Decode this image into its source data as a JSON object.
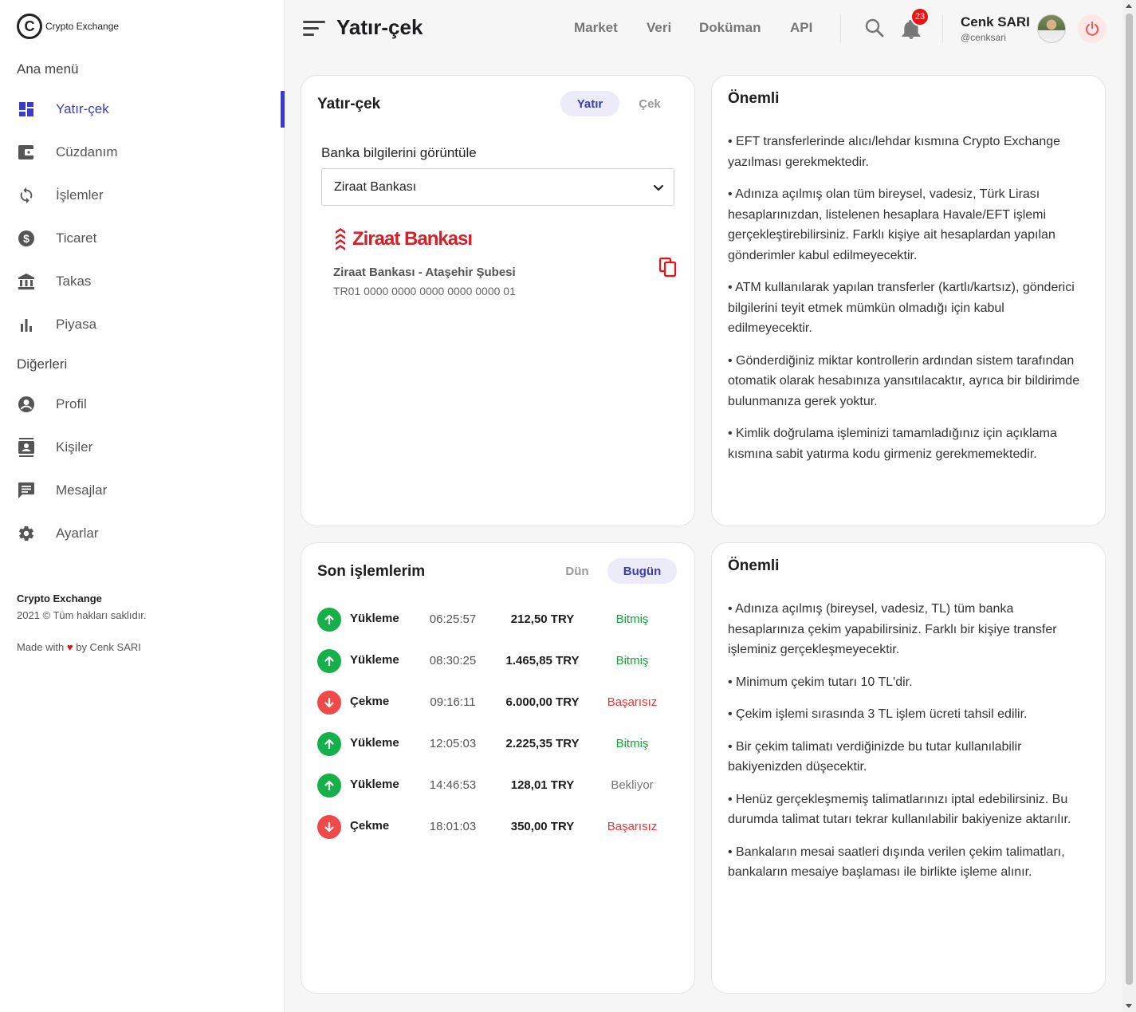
{
  "brand": {
    "mark": "C",
    "name": "Crypto Exchange"
  },
  "sidebar": {
    "main_title": "Ana menü",
    "main_items": [
      {
        "label": "Yatır-çek",
        "icon": "dashboard-icon",
        "active": true
      },
      {
        "label": "Cüzdanım",
        "icon": "wallet-icon"
      },
      {
        "label": "İşlemler",
        "icon": "sync-icon"
      },
      {
        "label": "Ticaret",
        "icon": "dollar-icon"
      },
      {
        "label": "Takas",
        "icon": "bank-icon"
      },
      {
        "label": "Piyasa",
        "icon": "bar-chart-icon"
      }
    ],
    "other_title": "Diğerleri",
    "other_items": [
      {
        "label": "Profil",
        "icon": "account-circle-icon"
      },
      {
        "label": "Kişiler",
        "icon": "contacts-icon"
      },
      {
        "label": "Mesajlar",
        "icon": "message-icon"
      },
      {
        "label": "Ayarlar",
        "icon": "gear-icon"
      }
    ],
    "footer": {
      "brand": "Crypto Exchange",
      "copyright": "2021 © Tüm hakları saklıdır.",
      "made_prefix": "Made with",
      "made_suffix": "by Cenk SARI"
    }
  },
  "header": {
    "title": "Yatır-çek",
    "nav": [
      "Market",
      "Veri",
      "Doküman",
      "API"
    ],
    "notification_count": "23",
    "user_name": "Cenk SARI",
    "user_handle": "@cenksari"
  },
  "deposit_card": {
    "title": "Yatır-çek",
    "tabs": [
      {
        "label": "Yatır",
        "active": true
      },
      {
        "label": "Çek",
        "active": false
      }
    ],
    "field_label": "Banka bilgilerini görüntüle",
    "selected_bank": "Ziraat Bankası",
    "bank_logo_text": "Ziraat Bankası",
    "branch": "Ziraat Bankası - Ataşehir Şubesi",
    "iban": "TR01 0000 0000 0000 0000 0000 01"
  },
  "transactions_card": {
    "title": "Son işlemlerim",
    "tabs": [
      {
        "label": "Dün",
        "active": false
      },
      {
        "label": "Bugün",
        "active": true
      }
    ],
    "rows": [
      {
        "direction": "up",
        "type": "Yükleme",
        "time": "06:25:57",
        "amount": "212,50 TRY",
        "status": "Bitmiş",
        "status_kind": "ok"
      },
      {
        "direction": "up",
        "type": "Yükleme",
        "time": "08:30:25",
        "amount": "1.465,85 TRY",
        "status": "Bitmiş",
        "status_kind": "ok"
      },
      {
        "direction": "down",
        "type": "Çekme",
        "time": "09:16:11",
        "amount": "6.000,00 TRY",
        "status": "Başarısız",
        "status_kind": "fail"
      },
      {
        "direction": "up",
        "type": "Yükleme",
        "time": "12:05:03",
        "amount": "2.225,35 TRY",
        "status": "Bitmiş",
        "status_kind": "ok"
      },
      {
        "direction": "up",
        "type": "Yükleme",
        "time": "14:46:53",
        "amount": "128,01 TRY",
        "status": "Bekliyor",
        "status_kind": "wait"
      },
      {
        "direction": "down",
        "type": "Çekme",
        "time": "18:01:03",
        "amount": "350,00 TRY",
        "status": "Başarısız",
        "status_kind": "fail"
      }
    ]
  },
  "important_deposit": {
    "title": "Önemli",
    "notes": [
      "• EFT transferlerinde alıcı/lehdar kısmına Crypto Exchange yazılması gerekmektedir.",
      "• Adınıza açılmış olan tüm bireysel, vadesiz, Türk Lirası hesaplarınızdan, listelenen hesaplara Havale/EFT işlemi gerçekleştirebilirsiniz. Farklı kişiye ait hesaplardan yapılan gönderimler kabul edilmeyecektir.",
      "• ATM kullanılarak yapılan transferler (kartlı/kartsız), gönderici bilgilerini teyit etmek mümkün olmadığı için kabul edilmeyecektir.",
      "• Gönderdiğiniz miktar kontrollerin ardından sistem tarafından otomatik olarak hesabınıza yansıtılacaktır, ayrıca bir bildirimde bulunmanıza gerek yoktur.",
      "• Kimlik doğrulama işleminizi tamamladığınız için açıklama kısmına sabit yatırma kodu girmeniz gerekmemektedir."
    ]
  },
  "important_withdraw": {
    "title": "Önemli",
    "notes": [
      "• Adınıza açılmış (bireysel, vadesiz, TL) tüm banka hesaplarınıza çekim yapabilirsiniz. Farklı bir kişiye transfer işleminiz gerçekleşmeyecektir.",
      "• Minimum çekim tutarı 10 TL'dir.",
      "• Çekim işlemi sırasında 3 TL işlem ücreti tahsil edilir.",
      "• Bir çekim talimatı verdiğinizde bu tutar kullanılabilir bakiyenizden düşecektir.",
      "• Henüz gerçekleşmemiş talimatlarınızı iptal edebilirsiniz. Bu durumda talimat tutarı tekrar kullanılabilir bakiyenize aktarılır.",
      "• Bankaların mesai saatleri dışında verilen çekim talimatları, bankaların mesaiye başlaması ile birlikte işleme alınır."
    ]
  },
  "colors": {
    "accent": "#3b3bc9",
    "success": "#16b04a",
    "danger": "#ef4a4a",
    "bank_red": "#d5202a"
  }
}
